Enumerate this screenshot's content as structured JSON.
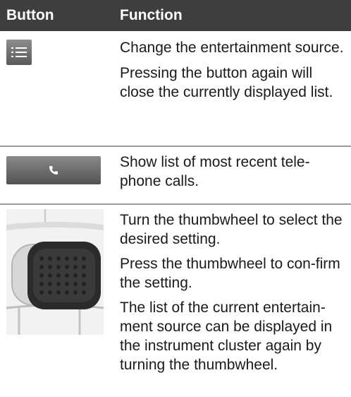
{
  "header": {
    "col_button": "Button",
    "col_function": "Function"
  },
  "rows": [
    {
      "icon": "list-icon",
      "paragraphs": [
        "Change the entertainment source.",
        "Pressing the button again will close the currently displayed list."
      ]
    },
    {
      "icon": "phone-icon",
      "paragraphs": [
        "Show list of most recent tele-phone calls."
      ]
    },
    {
      "icon": "thumbwheel-image",
      "paragraphs": [
        "Turn the thumbwheel to select the desired setting.",
        "Press the thumbwheel to con-firm the setting.",
        "The list of the current entertain-ment source can be displayed in the instrument cluster again by turning the thumbwheel."
      ]
    }
  ],
  "colors": {
    "header_bg": "#3e3e3e",
    "header_text": "#ffffff",
    "divider": "#9a9a9a",
    "button_gray": "#6e6e6e"
  }
}
